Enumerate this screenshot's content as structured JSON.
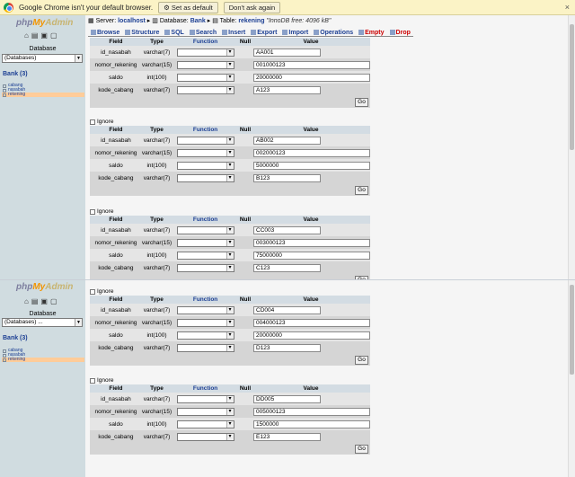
{
  "infobar": {
    "message": "Google Chrome isn't your default browser.",
    "set_default": "Set as default",
    "dont_ask": "Don't ask again",
    "close": "×"
  },
  "sidebar": {
    "logo_php": "php",
    "logo_my": "My",
    "logo_admin": "Admin",
    "database_label": "Database",
    "select_value_top": "(Databases)",
    "select_value_bottom": "(Databases) ...",
    "db_name": "Bank (3)",
    "tables": [
      "cabang",
      "nasabah",
      "rekening"
    ]
  },
  "header": {
    "server_label": "Server:",
    "server": "localhost",
    "database_label": "Database:",
    "database": "Bank",
    "table_label": "Table:",
    "table": "rekening",
    "info": "\"InnoDB free: 4096 kB\""
  },
  "tabs": [
    "Browse",
    "Structure",
    "SQL",
    "Search",
    "Insert",
    "Export",
    "Import",
    "Operations",
    "Empty",
    "Drop"
  ],
  "columns": {
    "field": "Field",
    "type": "Type",
    "function": "Function",
    "null": "Null",
    "value": "Value"
  },
  "ignore_label": "Ignore",
  "go_label": "Go",
  "fields": [
    {
      "name": "id_nasabah",
      "type": "varchar(7)"
    },
    {
      "name": "nomor_rekening",
      "type": "varchar(15)"
    },
    {
      "name": "saldo",
      "type": "int(100)"
    },
    {
      "name": "kode_cabang",
      "type": "varchar(7)"
    }
  ],
  "records": [
    [
      "AA001",
      "001000123",
      "20000000",
      "A123"
    ],
    [
      "AB002",
      "002000123",
      "5000000",
      "B123"
    ],
    [
      "CC003",
      "003000123",
      "75000000",
      "C123"
    ],
    [
      "CD004",
      "004000123",
      "20000000",
      "D123"
    ],
    [
      "DD005",
      "005000123",
      "1500000",
      "E123"
    ]
  ]
}
